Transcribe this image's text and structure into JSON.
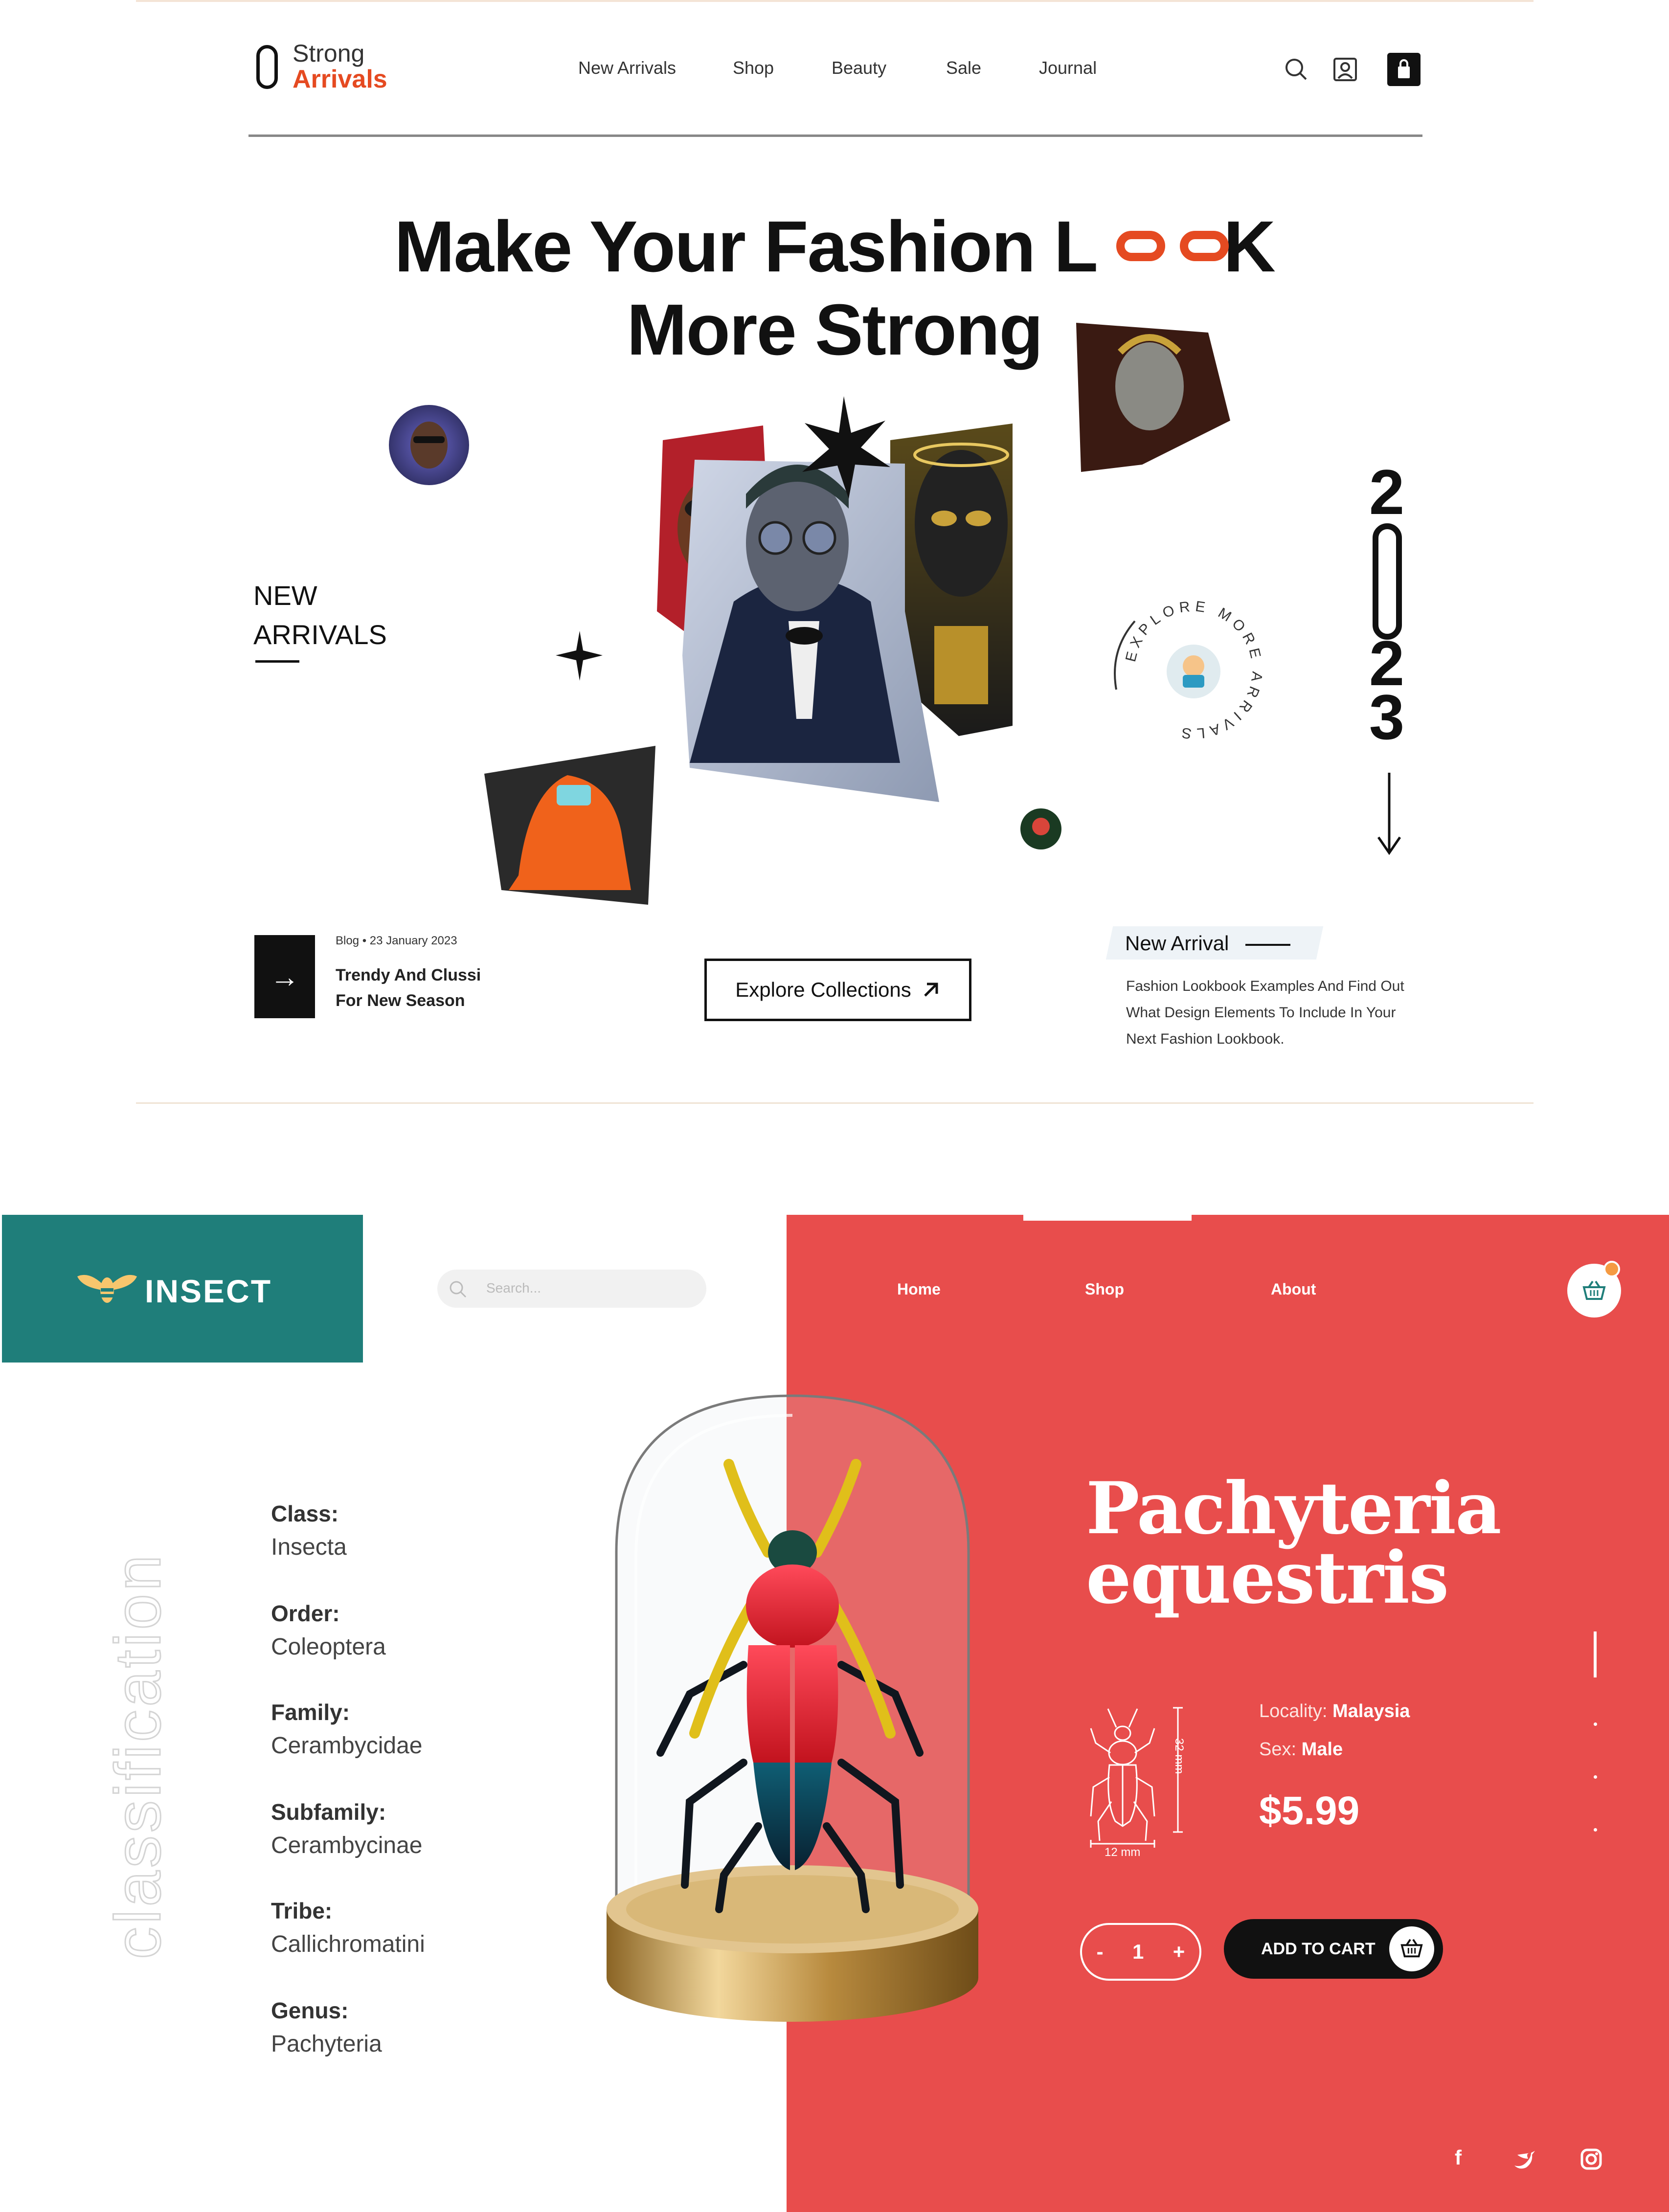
{
  "fashion": {
    "logo": {
      "line1": "Strong",
      "line2": "Arrivals"
    },
    "nav": [
      "New Arrivals",
      "Shop",
      "Beauty",
      "Sale",
      "Journal"
    ],
    "hero": {
      "line1a": "Make Your Fashion L",
      "line1b": "K",
      "line2": "More Strong"
    },
    "new_arrivals_label": [
      "NEW",
      "ARRIVALS"
    ],
    "year": [
      "2",
      "2",
      "3"
    ],
    "explore_circle_text": "EXPLORE MORE ARRIVALS",
    "blog": {
      "meta": "Blog  •  23 January 2023",
      "title": "Trendy And Clussi For New Season"
    },
    "explore_button": "Explore Collections",
    "new_arrival": {
      "title": "New Arrival",
      "text": "Fashion Lookbook Examples And Find Out What Design Elements To Include In Your Next Fashion Lookbook."
    },
    "accent_color": "#e54a21"
  },
  "insect": {
    "logo": "INSECT",
    "search_placeholder": "Search...",
    "nav": [
      "Home",
      "Shop",
      "About"
    ],
    "classification_label": "classification",
    "taxonomy": [
      {
        "label": "Class:",
        "value": "Insecta"
      },
      {
        "label": "Order:",
        "value": "Coleoptera"
      },
      {
        "label": "Family:",
        "value": "Cerambycidae"
      },
      {
        "label": "Subfamily:",
        "value": "Cerambycinae"
      },
      {
        "label": "Tribe:",
        "value": "Callichromatini"
      },
      {
        "label": "Genus:",
        "value": "Pachyteria"
      }
    ],
    "title_line1": "Pachyteria",
    "title_line2": "equestris",
    "locality_label": "Locality: ",
    "locality_value": "Malaysia",
    "sex_label": "Sex: ",
    "sex_value": "Male",
    "price": "$5.99",
    "dim_length": "32 mm",
    "dim_width": "12 mm",
    "quantity": "1",
    "minus": "-",
    "plus": "+",
    "add_to_cart": "ADD TO CART",
    "colors": {
      "teal": "#1f7e7a",
      "red": "#e84d4c"
    }
  }
}
